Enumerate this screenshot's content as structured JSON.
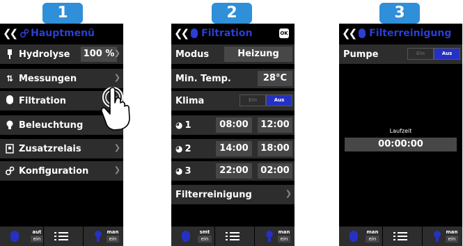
{
  "badges": [
    "1",
    "2",
    "3"
  ],
  "screen1": {
    "title": "Hauptmenü",
    "items": [
      {
        "label": "Hydrolyse",
        "value": "100 %",
        "icon": "hydrolysis-icon"
      },
      {
        "label": "Messungen",
        "icon": "measure-arrows-icon"
      },
      {
        "label": "Filtration",
        "icon": "pump-icon"
      },
      {
        "label": "Beleuchtung",
        "icon": "bulb-icon"
      },
      {
        "label": "Zusatzrelais",
        "icon": "relay-icon"
      },
      {
        "label": "Konfiguration",
        "icon": "gears-icon"
      }
    ],
    "bottom": {
      "left_top": "aut",
      "left_bottom": "ein",
      "right_top": "man",
      "right_bottom": "ein"
    }
  },
  "screen2": {
    "title": "Filtration",
    "ok_label": "OK",
    "modus_label": "Modus",
    "modus_value": "Heizung",
    "min_temp_label": "Min. Temp.",
    "min_temp_value": "28°C",
    "klima_label": "Klima",
    "toggle_on": "Ein",
    "toggle_off": "Aus",
    "timers": [
      {
        "num": "1",
        "start": "08:00",
        "end": "12:00"
      },
      {
        "num": "2",
        "start": "14:00",
        "end": "18:00"
      },
      {
        "num": "3",
        "start": "22:00",
        "end": "02:00"
      }
    ],
    "filter_label": "Filterreinigung",
    "bottom": {
      "left_top": "smt",
      "left_bottom": "ein",
      "right_top": "man",
      "right_bottom": "ein"
    }
  },
  "screen3": {
    "title": "Filterreinigung",
    "pumpe_label": "Pumpe",
    "toggle_on": "Ein",
    "toggle_off": "Aus",
    "laufzeit_label": "Laufzeit",
    "laufzeit_value": "00:00:00",
    "bottom": {
      "left_top": "man",
      "left_bottom": "ein",
      "right_top": "man",
      "right_bottom": "ein"
    }
  },
  "colors": {
    "accent": "#2f8fd8",
    "title_blue": "#2b3ed6",
    "toggle_on": "#2531c4",
    "row_bg": "#2d2d2d",
    "value_bg": "#474747"
  }
}
